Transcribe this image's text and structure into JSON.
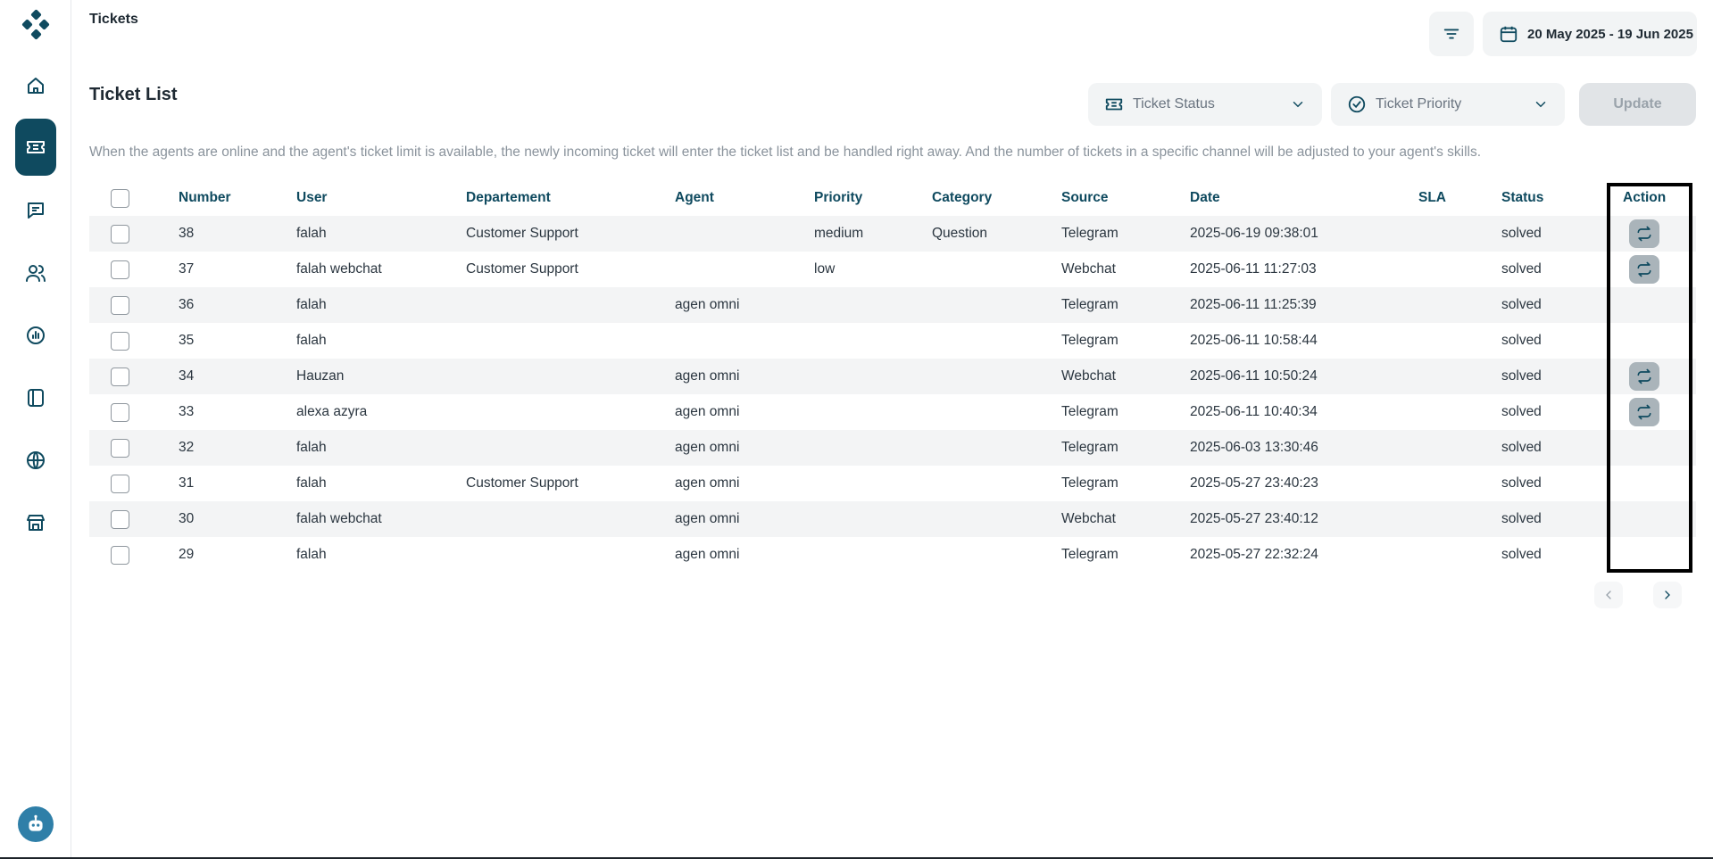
{
  "header": {
    "title": "Tickets",
    "date_range": "20 May 2025 - 19 Jun 2025"
  },
  "section": {
    "title": "Ticket List",
    "info": "When the agents are online and the agent's ticket limit is available, the newly incoming ticket will enter the ticket list and be handled right away. And the number of tickets in a specific channel will be adjusted to your agent's skills."
  },
  "filters": {
    "status_placeholder": "Ticket Status",
    "priority_placeholder": "Ticket Priority",
    "update_label": "Update"
  },
  "sidebar": {
    "items": [
      {
        "name": "home-icon"
      },
      {
        "name": "ticket-icon",
        "active": true
      },
      {
        "name": "chat-icon"
      },
      {
        "name": "users-icon"
      },
      {
        "name": "report-icon"
      },
      {
        "name": "book-icon"
      },
      {
        "name": "globe-icon"
      },
      {
        "name": "store-icon"
      }
    ]
  },
  "table": {
    "columns": {
      "number": "Number",
      "user": "User",
      "department": "Departement",
      "agent": "Agent",
      "priority": "Priority",
      "category": "Category",
      "source": "Source",
      "date": "Date",
      "sla": "SLA",
      "status": "Status",
      "action": "Action"
    },
    "rows": [
      {
        "number": "38",
        "user": "falah",
        "department": "Customer Support",
        "agent": "",
        "priority": "medium",
        "category": "Question",
        "source": "Telegram",
        "date": "2025-06-19 09:38:01",
        "sla": "",
        "status": "solved",
        "action": true
      },
      {
        "number": "37",
        "user": "falah webchat",
        "department": "Customer Support",
        "agent": "",
        "priority": "low",
        "category": "",
        "source": "Webchat",
        "date": "2025-06-11 11:27:03",
        "sla": "",
        "status": "solved",
        "action": true
      },
      {
        "number": "36",
        "user": "falah",
        "department": "",
        "agent": "agen omni",
        "priority": "",
        "category": "",
        "source": "Telegram",
        "date": "2025-06-11 11:25:39",
        "sla": "",
        "status": "solved",
        "action": false
      },
      {
        "number": "35",
        "user": "falah",
        "department": "",
        "agent": "",
        "priority": "",
        "category": "",
        "source": "Telegram",
        "date": "2025-06-11 10:58:44",
        "sla": "",
        "status": "solved",
        "action": false
      },
      {
        "number": "34",
        "user": "Hauzan",
        "department": "",
        "agent": "agen omni",
        "priority": "",
        "category": "",
        "source": "Webchat",
        "date": "2025-06-11 10:50:24",
        "sla": "",
        "status": "solved",
        "action": true
      },
      {
        "number": "33",
        "user": "alexa azyra",
        "department": "",
        "agent": "agen omni",
        "priority": "",
        "category": "",
        "source": "Telegram",
        "date": "2025-06-11 10:40:34",
        "sla": "",
        "status": "solved",
        "action": true
      },
      {
        "number": "32",
        "user": "falah",
        "department": "",
        "agent": "agen omni",
        "priority": "",
        "category": "",
        "source": "Telegram",
        "date": "2025-06-03 13:30:46",
        "sla": "",
        "status": "solved",
        "action": false
      },
      {
        "number": "31",
        "user": "falah",
        "department": "Customer Support",
        "agent": "agen omni",
        "priority": "",
        "category": "",
        "source": "Telegram",
        "date": "2025-05-27 23:40:23",
        "sla": "",
        "status": "solved",
        "action": false
      },
      {
        "number": "30",
        "user": "falah webchat",
        "department": "",
        "agent": "agen omni",
        "priority": "",
        "category": "",
        "source": "Webchat",
        "date": "2025-05-27 23:40:12",
        "sla": "",
        "status": "solved",
        "action": false
      },
      {
        "number": "29",
        "user": "falah",
        "department": "",
        "agent": "agen omni",
        "priority": "",
        "category": "",
        "source": "Telegram",
        "date": "2025-05-27 22:32:24",
        "sla": "",
        "status": "solved",
        "action": false
      }
    ]
  },
  "pagination": {
    "prev_icon": "chevron-left-icon",
    "next_icon": "chevron-right-icon"
  },
  "colors": {
    "brand": "#0f4a5f",
    "action_button": "#aab4ba",
    "row_stripe": "#f3f4f5"
  }
}
